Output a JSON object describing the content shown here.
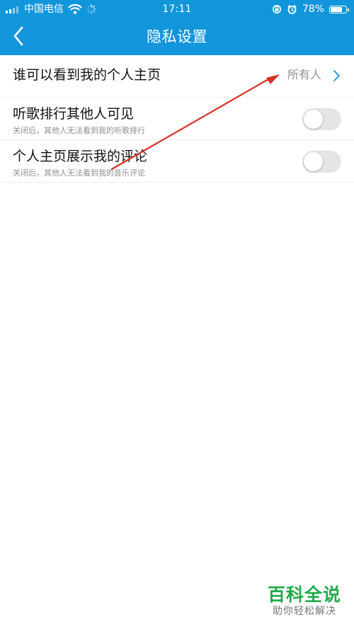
{
  "status_bar": {
    "carrier": "中国电信",
    "time": "17:11",
    "battery": "78%",
    "battery_level": 0.78
  },
  "header": {
    "title": "隐私设置",
    "accent_color": "#1296db"
  },
  "settings": {
    "profile_visibility": {
      "label": "谁可以看到我的个人主页",
      "value": "所有人"
    },
    "ranking_visibility": {
      "label": "听歌排行其他人可见",
      "description": "关闭后，其他人无法看到我的听歌排行",
      "enabled": false
    },
    "comments_visibility": {
      "label": "个人主页展示我的评论",
      "description": "关闭后，其他人无法看到我的音乐评论",
      "enabled": false
    }
  },
  "icons": {
    "back": "chevron-left-icon",
    "row_arrow": "chevron-right-icon",
    "wifi": "wifi-icon",
    "loading": "loading-icon",
    "orientation_lock": "orientation-lock-icon",
    "alarm": "alarm-icon",
    "battery": "battery-icon",
    "signal": "signal-icon"
  },
  "annotation": {
    "color": "#d93025"
  },
  "watermark": {
    "title": "百科全说",
    "subtitle": "助你轻松解决"
  }
}
